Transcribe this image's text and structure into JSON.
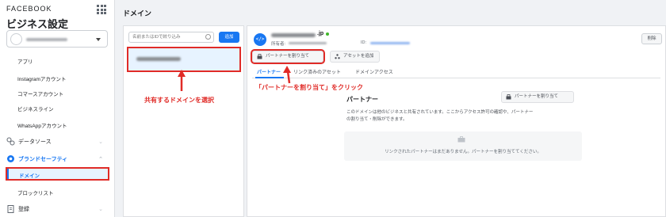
{
  "sidebar": {
    "brand": "FACEBOOK",
    "title": "ビジネス設定",
    "items": [
      {
        "label": "アプリ"
      },
      {
        "label": "Instagramアカウント"
      },
      {
        "label": "コマースアカウント"
      },
      {
        "label": "ビジネスライン"
      },
      {
        "label": "WhatsAppアカウント"
      }
    ],
    "section_data_sources": "データソース",
    "section_brand_safety": "ブランドセーフティ",
    "item_domain": "ドメイン",
    "item_block_list": "ブロックリスト",
    "section_register": "登録"
  },
  "header": {
    "title": "ドメイン"
  },
  "list": {
    "search_placeholder": "名前またはIDで絞り込み",
    "add_label": "追加"
  },
  "detail": {
    "domain_suffix": ".jp",
    "owner_label": "所有者:",
    "id_label": "ID:",
    "delete_label": "削除",
    "assign_partner_label": "パートナーを割り当て",
    "add_asset_label": "アセットを追加",
    "tabs": [
      {
        "label": "パートナー"
      },
      {
        "label": "リンク済みのアセット"
      },
      {
        "label": "ドメインアクセス"
      }
    ],
    "partner_heading": "パートナー",
    "partner_button_label": "パートナーを割り当て",
    "description_line1": "このドメインは他のビジネスと共有されています。ここからアクセス許可の確認や、パートナー",
    "description_line2": "の割り当て・削除ができます。",
    "empty_text": "リンクされたパートナーはまだありません。パートナーを割り当ててください。"
  },
  "annotations": {
    "select_domain": "共有するドメインを選択",
    "click_assign": "「パートナーを割り当て」をクリック"
  },
  "colors": {
    "accent": "#1877f2",
    "annotation": "#e02b27"
  }
}
